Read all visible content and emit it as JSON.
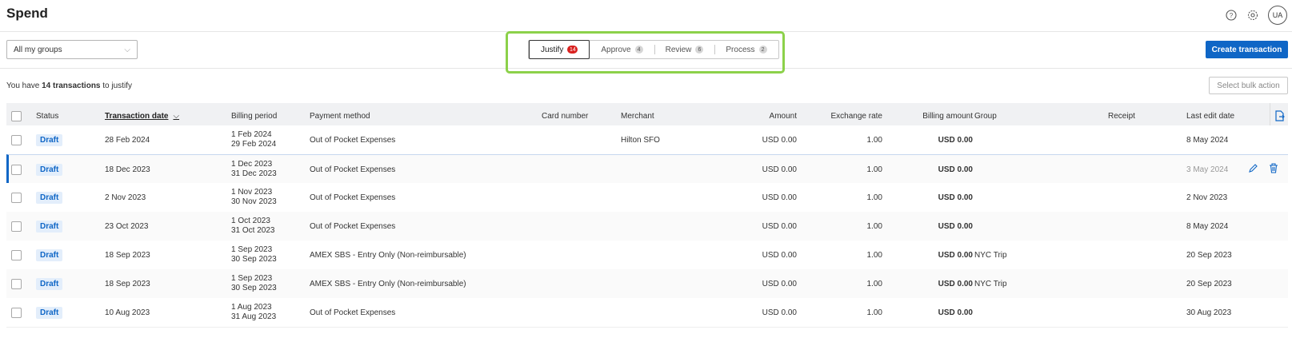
{
  "app": {
    "title": "Spend"
  },
  "topbar": {
    "avatar_initials": "UA"
  },
  "filters": {
    "group_select": "All my groups"
  },
  "tabs": [
    {
      "label": "Justify",
      "count": "14",
      "active": true
    },
    {
      "label": "Approve",
      "count": "4",
      "active": false
    },
    {
      "label": "Review",
      "count": "6",
      "active": false
    },
    {
      "label": "Process",
      "count": "2",
      "active": false
    }
  ],
  "actions": {
    "create": "Create transaction",
    "bulk": "Select bulk action"
  },
  "summary": {
    "prefix": "You have",
    "count": "14 transactions",
    "suffix": "to justify"
  },
  "table": {
    "headers": {
      "status": "Status",
      "transaction_date": "Transaction date",
      "billing_period": "Billing period",
      "payment_method": "Payment method",
      "card_number": "Card number",
      "merchant": "Merchant",
      "amount": "Amount",
      "exchange_rate": "Exchange rate",
      "billing_amount": "Billing amount",
      "group": "Group",
      "receipt": "Receipt",
      "last_edit": "Last edit date"
    },
    "rows": [
      {
        "status": "Draft",
        "date": "28 Feb 2024",
        "period_start": "1 Feb 2024",
        "period_end": "29 Feb 2024",
        "payment": "Out of Pocket Expenses",
        "card": "",
        "merchant": "Hilton SFO",
        "amount": "USD 0.00",
        "rate": "1.00",
        "billing": "USD 0.00",
        "group": "",
        "receipt": "",
        "last_edit": "8 May 2024"
      },
      {
        "status": "Draft",
        "date": "18 Dec 2023",
        "period_start": "1 Dec 2023",
        "period_end": "31 Dec 2023",
        "payment": "Out of Pocket Expenses",
        "card": "",
        "merchant": "",
        "amount": "USD 0.00",
        "rate": "1.00",
        "billing": "USD 0.00",
        "group": "",
        "receipt": "",
        "last_edit": "3 May 2024"
      },
      {
        "status": "Draft",
        "date": "2 Nov 2023",
        "period_start": "1 Nov 2023",
        "period_end": "30 Nov 2023",
        "payment": "Out of Pocket Expenses",
        "card": "",
        "merchant": "",
        "amount": "USD 0.00",
        "rate": "1.00",
        "billing": "USD 0.00",
        "group": "",
        "receipt": "",
        "last_edit": "2 Nov 2023"
      },
      {
        "status": "Draft",
        "date": "23 Oct 2023",
        "period_start": "1 Oct 2023",
        "period_end": "31 Oct 2023",
        "payment": "Out of Pocket Expenses",
        "card": "",
        "merchant": "",
        "amount": "USD 0.00",
        "rate": "1.00",
        "billing": "USD 0.00",
        "group": "",
        "receipt": "",
        "last_edit": "8 May 2024"
      },
      {
        "status": "Draft",
        "date": "18 Sep 2023",
        "period_start": "1 Sep 2023",
        "period_end": "30 Sep 2023",
        "payment": "AMEX SBS - Entry Only (Non-reimbursable)",
        "card": "",
        "merchant": "",
        "amount": "USD 0.00",
        "rate": "1.00",
        "billing": "USD 0.00",
        "group": "NYC Trip",
        "receipt": "",
        "last_edit": "20 Sep 2023"
      },
      {
        "status": "Draft",
        "date": "18 Sep 2023",
        "period_start": "1 Sep 2023",
        "period_end": "30 Sep 2023",
        "payment": "AMEX SBS - Entry Only (Non-reimbursable)",
        "card": "",
        "merchant": "",
        "amount": "USD 0.00",
        "rate": "1.00",
        "billing": "USD 0.00",
        "group": "NYC Trip",
        "receipt": "",
        "last_edit": "20 Sep 2023"
      },
      {
        "status": "Draft",
        "date": "10 Aug 2023",
        "period_start": "1 Aug 2023",
        "period_end": "31 Aug 2023",
        "payment": "Out of Pocket Expenses",
        "card": "",
        "merchant": "",
        "amount": "USD 0.00",
        "rate": "1.00",
        "billing": "USD 0.00",
        "group": "",
        "receipt": "",
        "last_edit": "30 Aug 2023"
      }
    ]
  },
  "colors": {
    "accent": "#0f66c6",
    "highlight": "#8cd14a",
    "badge_red": "#d9211f"
  },
  "icons": {
    "help": "help-icon",
    "settings": "settings-icon",
    "chevron": "chevron-down-icon",
    "export": "export-icon",
    "edit": "edit-icon",
    "delete": "delete-icon"
  }
}
